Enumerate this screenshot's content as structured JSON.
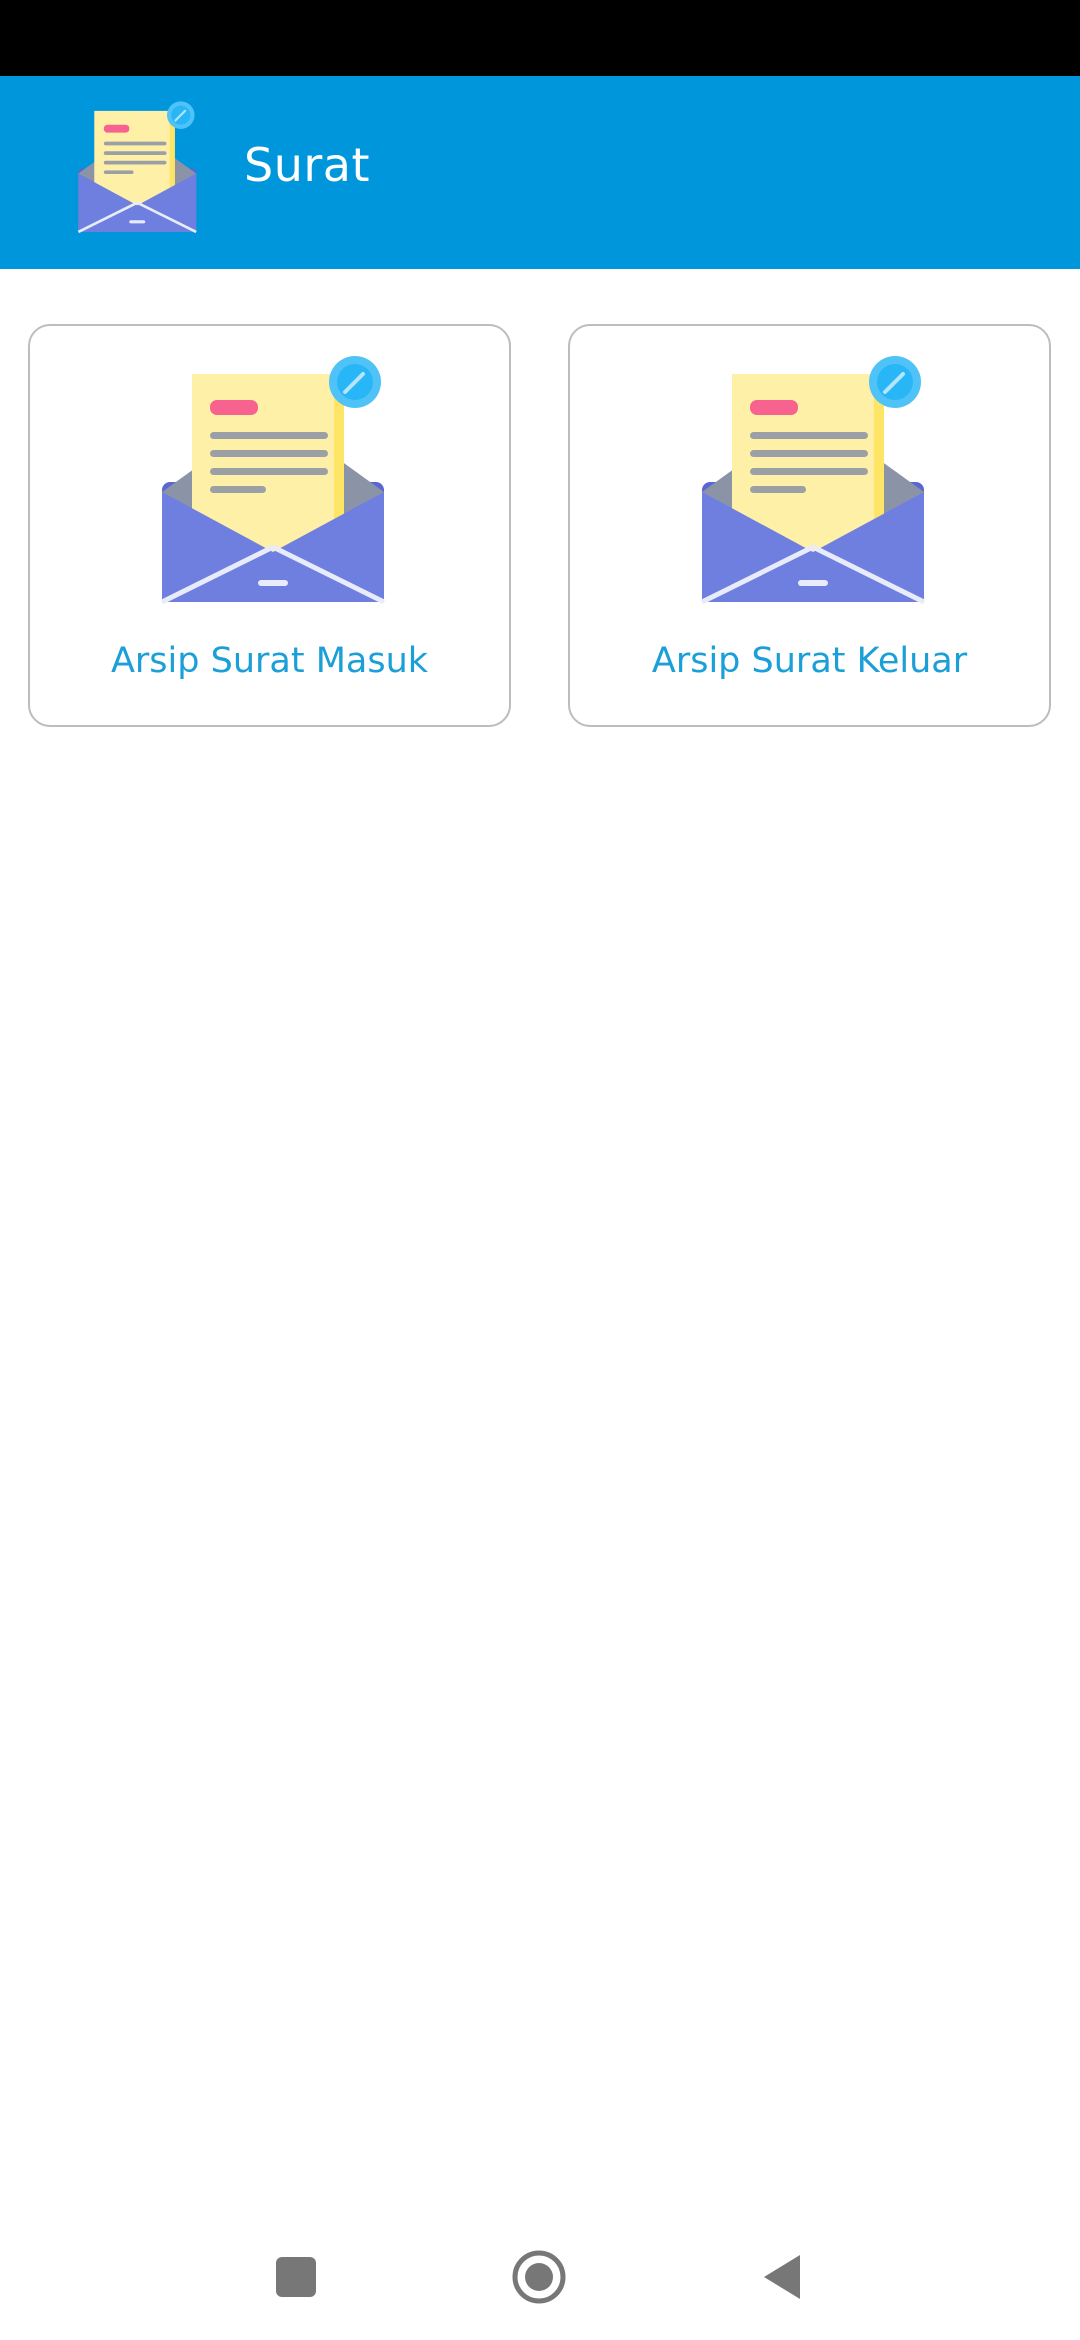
{
  "status_bar": {},
  "app_bar": {
    "title": "Surat",
    "logo_icon": "open-envelope-letter-icon",
    "background_color": "#0096DB"
  },
  "menu": {
    "items": [
      {
        "label": "Arsip Surat Masuk",
        "icon": "open-envelope-letter-icon"
      },
      {
        "label": "Arsip Surat Keluar",
        "icon": "open-envelope-letter-icon"
      }
    ],
    "label_color": "#1A9FD8"
  },
  "nav_bar": {
    "buttons": [
      "recents-icon",
      "home-icon",
      "back-icon"
    ]
  }
}
